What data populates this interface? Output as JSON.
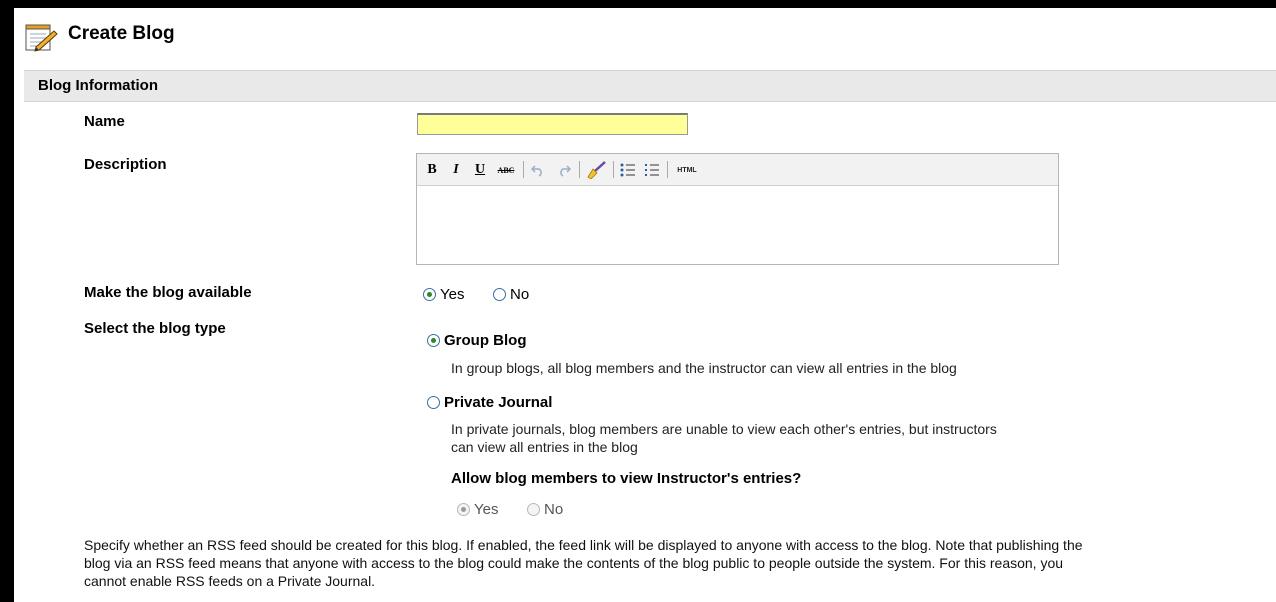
{
  "page": {
    "title": "Create Blog"
  },
  "section": {
    "title": "Blog Information"
  },
  "name_field": {
    "label": "Name",
    "value": "",
    "placeholder": ""
  },
  "description": {
    "label": "Description",
    "toolbar": {
      "bold": "B",
      "italic": "I",
      "underline": "U",
      "strike": "ABC",
      "html": "HTML"
    },
    "value": ""
  },
  "availability": {
    "label": "Make the blog available",
    "options": [
      "Yes",
      "No"
    ],
    "selected": "Yes"
  },
  "blog_type": {
    "label": "Select the blog type",
    "group": {
      "title": "Group Blog",
      "desc": "In group blogs, all blog members and the instructor can view all entries in the blog"
    },
    "private": {
      "title": "Private Journal",
      "desc_line1": "In private journals, blog members are unable to view each other's entries, but instructors",
      "desc_line2": "can view all entries in the blog"
    },
    "selected": "Group Blog"
  },
  "instructor_entries": {
    "question": "Allow blog members to view Instructor's entries?",
    "options": [
      "Yes",
      "No"
    ],
    "selected": "Yes"
  },
  "rss": {
    "line1": "Specify whether an RSS feed should be created for this blog. If enabled, the feed link will be displayed to anyone with access to the blog. Note that publishing the",
    "line2": "blog via an RSS feed means that anyone with access to the blog could make the contents of the blog public to people outside the system. For this reason, you",
    "line3": "cannot enable RSS feeds on a Private Journal."
  },
  "colors": {
    "input_highlight": "#ffff99",
    "section_bar": "#e9e9e9",
    "radio_selected": "#2a8a2a"
  }
}
